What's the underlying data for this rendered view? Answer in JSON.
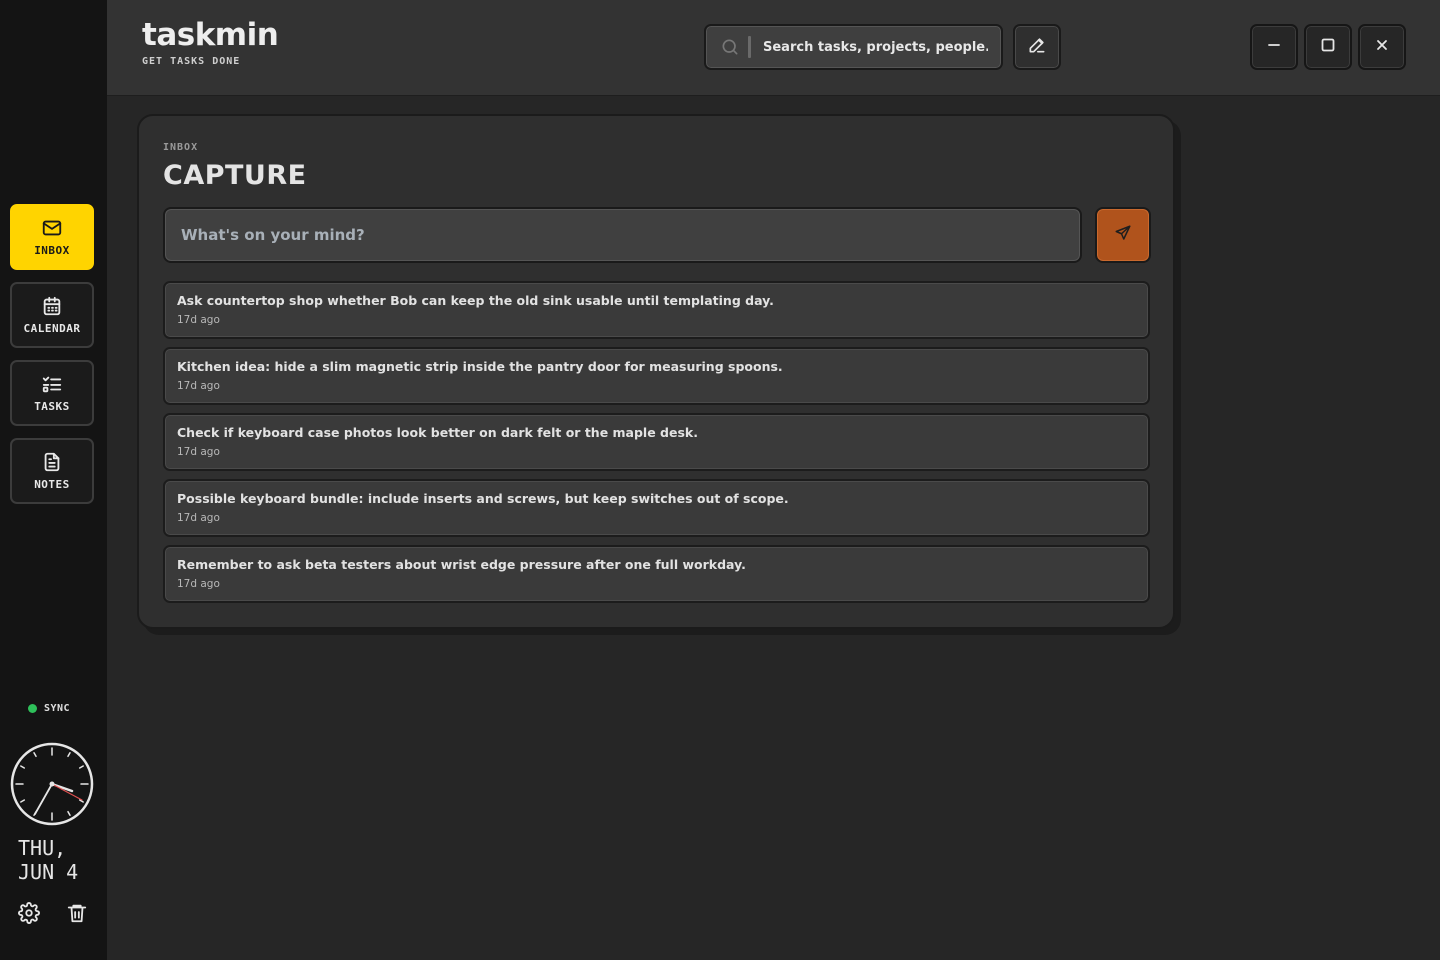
{
  "app": {
    "name": "taskmin",
    "tagline": "GET TASKS DONE"
  },
  "colors": {
    "accent": "#ffd400",
    "send": "#b0531c",
    "sync": "#2ec05a"
  },
  "sidebar": {
    "items": [
      {
        "label": "INBOX",
        "icon": "mail-icon",
        "active": true
      },
      {
        "label": "CALENDAR",
        "icon": "calendar-icon",
        "active": false
      },
      {
        "label": "TASKS",
        "icon": "list-check-icon",
        "active": false
      },
      {
        "label": "NOTES",
        "icon": "file-text-icon",
        "active": false
      }
    ],
    "sync_label": "SYNC",
    "date": "THU,\nJUN 4",
    "bottom_icons": [
      "gear-icon",
      "trash-icon"
    ]
  },
  "header": {
    "search_placeholder": "Search tasks, projects, people...",
    "icons": [
      "search-icon",
      "pencil-icon",
      "minimize-icon",
      "maximize-icon",
      "close-icon"
    ]
  },
  "panel": {
    "kicker": "INBOX",
    "title": "CAPTURE",
    "capture_placeholder": "What's on your mind?",
    "send_icon": "send-icon",
    "items": [
      {
        "text": "Ask countertop shop whether Bob can keep the old sink usable until templating day.",
        "age": "17d ago"
      },
      {
        "text": "Kitchen idea: hide a slim magnetic strip inside the pantry door for measuring spoons.",
        "age": "17d ago"
      },
      {
        "text": "Check if keyboard case photos look better on dark felt or the maple desk.",
        "age": "17d ago"
      },
      {
        "text": "Possible keyboard bundle: include inserts and screws, but keep switches out of scope.",
        "age": "17d ago"
      },
      {
        "text": "Remember to ask beta testers about wrist edge pressure after one full workday.",
        "age": "17d ago"
      }
    ]
  }
}
